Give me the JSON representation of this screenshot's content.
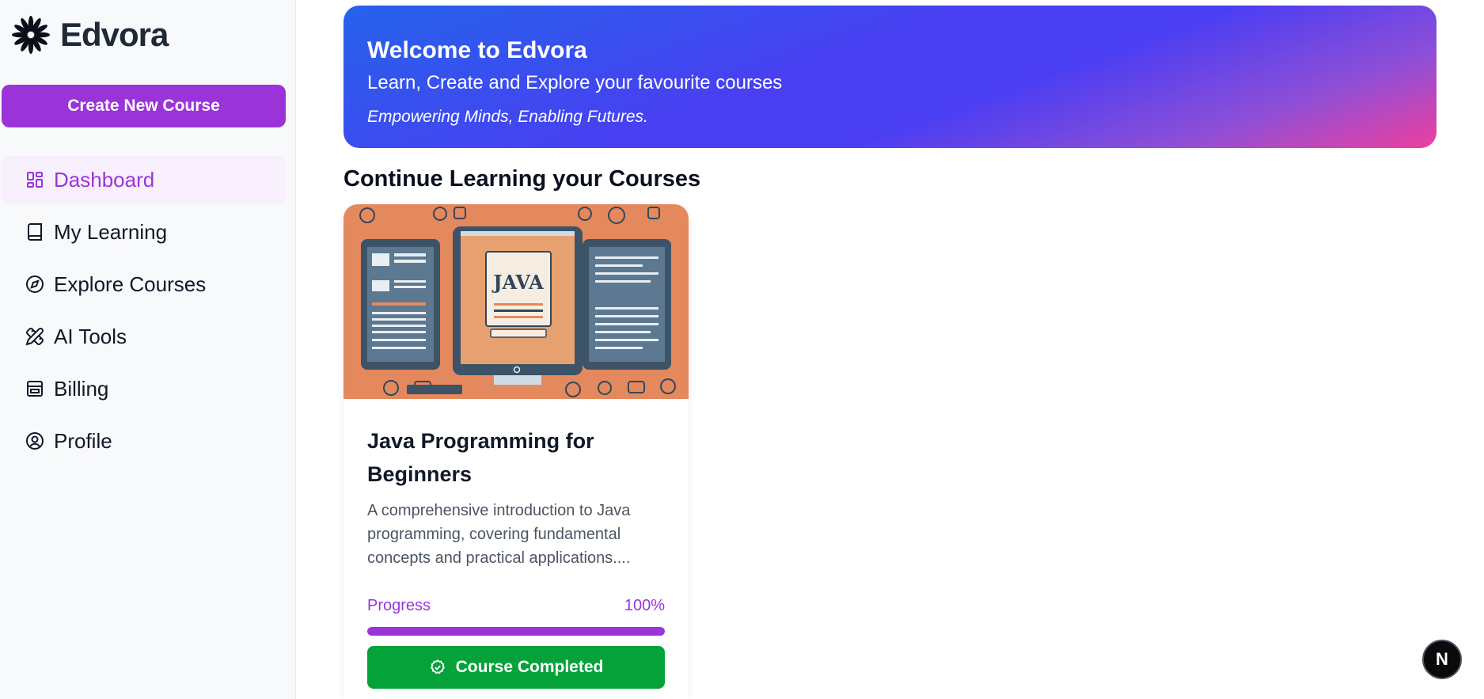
{
  "app": {
    "name": "Edvora"
  },
  "sidebar": {
    "create_button_label": "Create New Course",
    "items": [
      {
        "label": "Dashboard",
        "icon": "dashboard-icon",
        "active": true
      },
      {
        "label": "My Learning",
        "icon": "book-icon",
        "active": false
      },
      {
        "label": "Explore Courses",
        "icon": "compass-icon",
        "active": false
      },
      {
        "label": "AI Tools",
        "icon": "pencil-ruler-icon",
        "active": false
      },
      {
        "label": "Billing",
        "icon": "wallet-icon",
        "active": false
      },
      {
        "label": "Profile",
        "icon": "user-circle-icon",
        "active": false
      }
    ]
  },
  "banner": {
    "title": "Welcome to Edvora",
    "subtitle": "Learn, Create and Explore your favourite courses",
    "tagline": "Empowering Minds, Enabling Futures."
  },
  "section": {
    "title": "Continue Learning your Courses"
  },
  "courses": [
    {
      "title": "Java Programming for Beginners",
      "description": "A comprehensive introduction to Java programming, covering fundamental concepts and practical applications....",
      "progress_label": "Progress",
      "progress_text": "100%",
      "progress_value": 1.0,
      "status_button_label": "Course Completed",
      "thumbnail_text": "JAVA"
    }
  ],
  "dev_badge": {
    "letter": "N"
  },
  "colors": {
    "accent": "#9a34d9",
    "success": "#05a23a",
    "banner_start": "#2563eb",
    "banner_end": "#ee3f9e"
  }
}
